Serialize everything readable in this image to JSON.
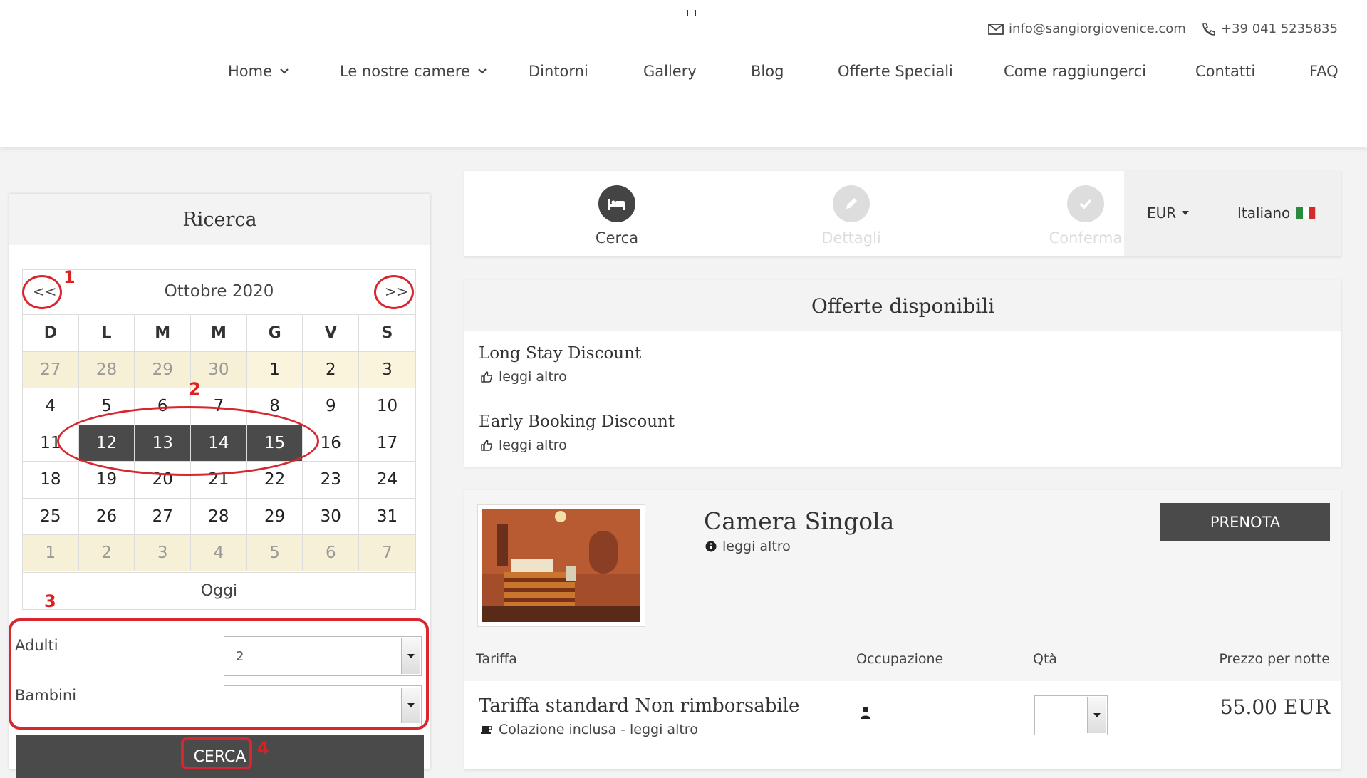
{
  "header": {
    "email": "info@sangiorgiovenice.com",
    "phone": "+39 041 5235835",
    "nav": [
      {
        "label": "Home"
      },
      {
        "label": "Le nostre camere"
      },
      {
        "label": "Dintorni"
      },
      {
        "label": "Gallery"
      },
      {
        "label": "Blog"
      },
      {
        "label": "Offerte Speciali"
      },
      {
        "label": "Come raggiungerci"
      },
      {
        "label": "Contatti"
      },
      {
        "label": "FAQ"
      }
    ]
  },
  "search": {
    "title": "Ricerca",
    "calendar": {
      "prev": "<<",
      "next": ">>",
      "month": "Ottobre 2020",
      "weekdays": [
        "D",
        "L",
        "M",
        "M",
        "G",
        "V",
        "S"
      ],
      "weeks": [
        [
          "27",
          "28",
          "29",
          "30",
          "1",
          "2",
          "3"
        ],
        [
          "4",
          "5",
          "6",
          "7",
          "8",
          "9",
          "10"
        ],
        [
          "11",
          "12",
          "13",
          "14",
          "15",
          "16",
          "17"
        ],
        [
          "18",
          "19",
          "20",
          "21",
          "22",
          "23",
          "24"
        ],
        [
          "25",
          "26",
          "27",
          "28",
          "29",
          "30",
          "31"
        ],
        [
          "1",
          "2",
          "3",
          "4",
          "5",
          "6",
          "7"
        ]
      ],
      "selected": [
        "12",
        "13",
        "14",
        "15"
      ],
      "today": "Oggi"
    },
    "adults_label": "Adulti",
    "adults_value": "2",
    "children_label": "Bambini",
    "children_value": "",
    "button": "CERCA"
  },
  "annotations": [
    "1",
    "2",
    "3",
    "4"
  ],
  "steps": [
    {
      "label": "Cerca",
      "active": true,
      "icon": "bed-icon"
    },
    {
      "label": "Dettagli",
      "active": false,
      "icon": "pencil-icon"
    },
    {
      "label": "Conferma",
      "active": false,
      "icon": "check-icon"
    }
  ],
  "prefs": {
    "currency": "EUR",
    "language": "Italiano"
  },
  "offers": {
    "title": "Offerte disponibili",
    "items": [
      {
        "name": "Long Stay Discount",
        "more": "leggi altro"
      },
      {
        "name": "Early Booking Discount",
        "more": "leggi altro"
      }
    ]
  },
  "room": {
    "name": "Camera Singola",
    "more": "leggi altro",
    "book": "PRENOTA",
    "columns": {
      "rate": "Tariffa",
      "occupancy": "Occupazione",
      "qty": "Qtà",
      "price": "Prezzo per notte"
    },
    "rates": [
      {
        "name": "Tariffa standard Non rimborsabile",
        "sub": "Colazione inclusa - leggi altro",
        "price": "55.00 EUR"
      }
    ]
  },
  "colors": {
    "dark": "#4a4a4a",
    "annotation": "#d8262e",
    "calendar_bg": "#f9f4db"
  }
}
